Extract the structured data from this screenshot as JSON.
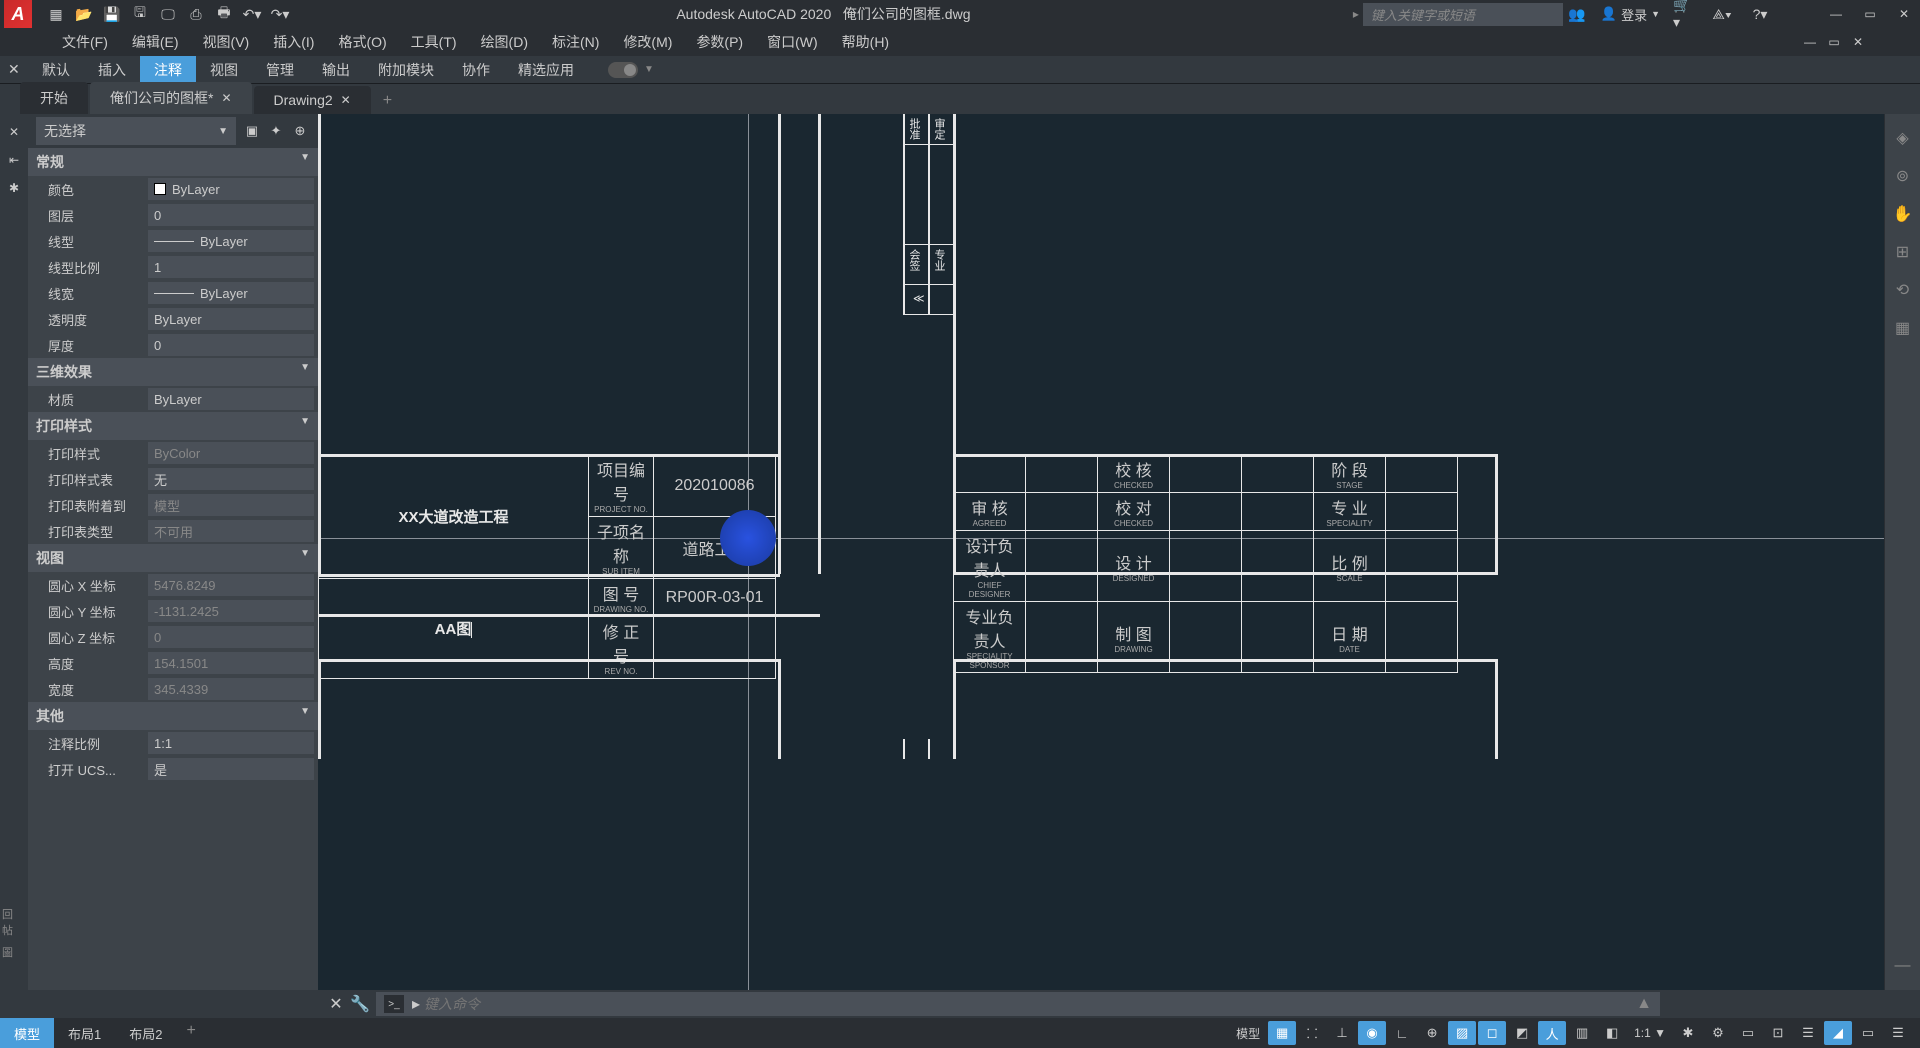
{
  "title": {
    "app": "Autodesk AutoCAD 2020",
    "file": "俺们公司的图框.dwg"
  },
  "search": {
    "placeholder": "键入关键字或短语"
  },
  "login": "登录",
  "menu": [
    "文件(F)",
    "编辑(E)",
    "视图(V)",
    "插入(I)",
    "格式(O)",
    "工具(T)",
    "绘图(D)",
    "标注(N)",
    "修改(M)",
    "参数(P)",
    "窗口(W)",
    "帮助(H)"
  ],
  "ribbon": [
    "默认",
    "插入",
    "注释",
    "视图",
    "管理",
    "输出",
    "附加模块",
    "协作",
    "精选应用"
  ],
  "ribbon_active": 2,
  "file_tabs": [
    {
      "label": "开始",
      "closable": false
    },
    {
      "label": "俺们公司的图框*",
      "closable": true,
      "active": true
    },
    {
      "label": "Drawing2",
      "closable": true
    }
  ],
  "props": {
    "selection": "无选择",
    "sections": [
      {
        "title": "常规",
        "rows": [
          {
            "label": "颜色",
            "value": "ByLayer",
            "swatch": true
          },
          {
            "label": "图层",
            "value": "0"
          },
          {
            "label": "线型",
            "value": "ByLayer",
            "line": true
          },
          {
            "label": "线型比例",
            "value": "1"
          },
          {
            "label": "线宽",
            "value": "ByLayer",
            "line": true
          },
          {
            "label": "透明度",
            "value": "ByLayer"
          },
          {
            "label": "厚度",
            "value": "0"
          }
        ]
      },
      {
        "title": "三维效果",
        "rows": [
          {
            "label": "材质",
            "value": "ByLayer"
          }
        ]
      },
      {
        "title": "打印样式",
        "rows": [
          {
            "label": "打印样式",
            "value": "ByColor",
            "readonly": true
          },
          {
            "label": "打印样式表",
            "value": "无"
          },
          {
            "label": "打印表附着到",
            "value": "模型",
            "readonly": true
          },
          {
            "label": "打印表类型",
            "value": "不可用",
            "readonly": true
          }
        ]
      },
      {
        "title": "视图",
        "rows": [
          {
            "label": "圆心 X 坐标",
            "value": "5476.8249",
            "readonly": true
          },
          {
            "label": "圆心 Y 坐标",
            "value": "-1131.2425",
            "readonly": true
          },
          {
            "label": "圆心 Z 坐标",
            "value": "0",
            "readonly": true
          },
          {
            "label": "高度",
            "value": "154.1501",
            "readonly": true
          },
          {
            "label": "宽度",
            "value": "345.4339",
            "readonly": true
          }
        ]
      },
      {
        "title": "其他",
        "rows": [
          {
            "label": "注释比例",
            "value": "1:1"
          },
          {
            "label": "打开 UCS...",
            "value": "是"
          }
        ]
      }
    ]
  },
  "drawing": {
    "project_name": "XX大道改造工程",
    "sheet_name": "AA图",
    "table1": [
      {
        "label_cn": "项目编号",
        "label_en": "PROJECT NO.",
        "value": "202010086"
      },
      {
        "label_cn": "子项名称",
        "label_en": "SUB ITEM",
        "value": "道路工程"
      },
      {
        "label_cn": "图    号",
        "label_en": "DRAWING NO.",
        "value": "RP00R-03-01"
      },
      {
        "label_cn": "修 正 号",
        "label_en": "REV NO.",
        "value": ""
      }
    ],
    "table2_left": [
      {
        "label_cn": "审        核",
        "label_en": "AGREED"
      },
      {
        "label_cn": "设计负责人",
        "label_en": "CHIEF DESIGNER"
      },
      {
        "label_cn": "专业负责人",
        "label_en": "SPECIALITY SPONSOR"
      }
    ],
    "table2_mid": [
      {
        "label_cn": "校        核",
        "label_en": "CHECKED"
      },
      {
        "label_cn": "校        对",
        "label_en": "CHECKED"
      },
      {
        "label_cn": "设        计",
        "label_en": "DESIGNED"
      },
      {
        "label_cn": "制        图",
        "label_en": "DRAWING"
      }
    ],
    "table2_right": [
      {
        "label_cn": "阶        段",
        "label_en": "STAGE"
      },
      {
        "label_cn": "专        业",
        "label_en": "SPECIALITY"
      },
      {
        "label_cn": "比        例",
        "label_en": "SCALE"
      },
      {
        "label_cn": "日        期",
        "label_en": "DATE"
      }
    ],
    "vtext1": "批准",
    "vtext2": "审定",
    "vtext3": "会签",
    "vtext4": "专业"
  },
  "cmd": {
    "placeholder": "键入命令"
  },
  "layout_tabs": [
    "模型",
    "布局1",
    "布局2"
  ],
  "status": {
    "model": "模型",
    "scale": "1:1"
  }
}
